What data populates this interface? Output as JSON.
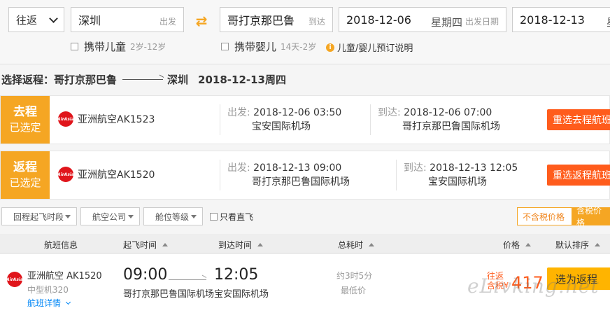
{
  "search": {
    "trip_type": "往返",
    "from_city": "深圳",
    "from_label": "出发",
    "to_city": "哥打京那巴鲁",
    "to_label": "到达",
    "depart_date": "2018-12-06",
    "depart_weekday": "星期四",
    "depart_label": "出发日期",
    "return_date": "2018-12-13",
    "return_weekday": "星",
    "with_child": "携带儿童",
    "child_hint": "2岁-12岁",
    "with_infant": "携带婴儿",
    "infant_hint": "14天-2岁",
    "booking_info": "儿童/婴儿预订说明"
  },
  "route": {
    "prefix": "选择返程：哥打京那巴鲁",
    "to": "深圳",
    "date": "2018-12-13周四"
  },
  "outbound": {
    "tag_main": "去程",
    "tag_sub": "已选定",
    "airline": "亚洲航空AK1523",
    "dep_label": "出发:",
    "dep_time": "2018-12-06 03:50",
    "dep_airport": "宝安国际机场",
    "arr_label": "到达:",
    "arr_time": "2018-12-06 07:00",
    "arr_airport": "哥打京那巴鲁国际机场",
    "rebook": "重选去程航班"
  },
  "inbound": {
    "tag_main": "返程",
    "tag_sub": "已选定",
    "airline": "亚洲航空AK1520",
    "dep_label": "出发:",
    "dep_time": "2018-12-13 09:00",
    "dep_airport": "哥打京那巴鲁国际机场",
    "arr_label": "到达:",
    "arr_time": "2018-12-13 12:05",
    "arr_airport": "宝安国际机场",
    "rebook": "重选返程航班"
  },
  "filters": {
    "dep_period": "回程起飞时段",
    "airline": "航空公司",
    "cabin": "舱位等级",
    "direct_only": "只看直飞",
    "price_excl": "不含税价格",
    "price_incl": "含税价格"
  },
  "table_header": {
    "flight_info": "航班信息",
    "dep_time": "起飞时间",
    "arr_time": "到达时间",
    "duration": "总耗时",
    "price": "价格",
    "sort": "默认排序"
  },
  "result": {
    "airline": "亚洲航空 AK1520",
    "aircraft": "中型机320",
    "details": "航班详情",
    "dep_time": "09:00",
    "arr_time": "12:05",
    "dep_airport": "哥打京那巴鲁国际机场",
    "arr_airport": "宝安国际机场",
    "duration": "约3时5分",
    "lowest": "最低价",
    "price_line1": "往返",
    "price_line2": "含税",
    "currency": "¥",
    "price": "417",
    "select": "选为返程"
  },
  "logo_text": "AirAsia",
  "watermark": "eLivking.net",
  "colors": {
    "accent": "#f5a623",
    "action": "#ff5c1c",
    "select_button": "#ffb400",
    "link": "#0086f6"
  }
}
